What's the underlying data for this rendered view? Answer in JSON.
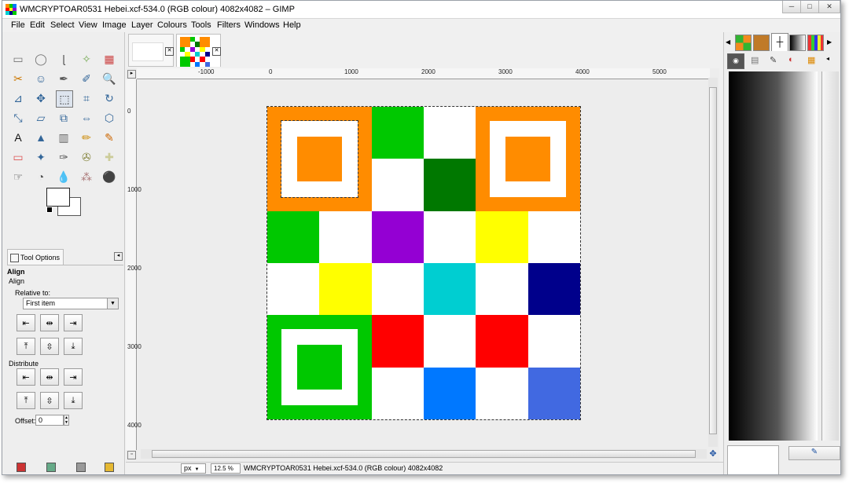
{
  "window": {
    "title": "WMCRYPTOAR0531 Hebei.xcf-534.0 (RGB colour) 4082x4082 – GIMP",
    "minimize": "─",
    "restore": "□",
    "close": "✕"
  },
  "menu": [
    "File",
    "Edit",
    "Select",
    "View",
    "Image",
    "Layer",
    "Colours",
    "Tools",
    "Filters",
    "Windows",
    "Help"
  ],
  "toolbox": {
    "tool_options_tab": "Tool Options",
    "section_title": "Align",
    "section_subtitle": "Align",
    "relative_to_label": "Relative to:",
    "relative_to_value": "First item",
    "distribute_label": "Distribute",
    "offset_label": "Offset:",
    "offset_value": "0",
    "tools": [
      "rect-select",
      "ellipse-select",
      "free-select",
      "fuzzy-select",
      "select-by-color",
      "scissors",
      "foreground-select",
      "paths",
      "color-picker",
      "zoom",
      "measure",
      "move",
      "align",
      "crop",
      "rotate",
      "scale",
      "shear",
      "perspective",
      "flip",
      "cage-transform",
      "text",
      "bucket-fill",
      "blend",
      "pencil",
      "paintbrush",
      "eraser",
      "airbrush",
      "ink",
      "clone",
      "heal",
      "smudge",
      "dodge-burn",
      "blur-sharpen",
      "convolve",
      "fill"
    ]
  },
  "ruler": {
    "h_labels": [
      "-1000",
      "0",
      "1000",
      "2000",
      "3000",
      "4000",
      "5000"
    ],
    "v_labels": [
      "0",
      "1000",
      "2000",
      "3000",
      "4000"
    ]
  },
  "status": {
    "unit": "px",
    "zoom": "12.5 %",
    "text": "WMCRYPTOAR0531 Hebei.xcf-534.0 (RGB colour) 4082x4082"
  },
  "colors": {
    "orange": "#ff8c00",
    "green": "#00c800",
    "darkgreen": "#007800",
    "purple": "#9400d3",
    "yellow": "#ffff00",
    "cyan": "#00ced1",
    "navy": "#00008b",
    "red": "#ff0000",
    "blue": "#0078ff",
    "royal": "#4169e1",
    "white": "#ffffff"
  },
  "image_grid": [
    [
      "orange",
      "orange",
      "green",
      "white",
      "orange",
      "orange"
    ],
    [
      "orange",
      "orange",
      "white",
      "darkgreen",
      "orange",
      "orange"
    ],
    [
      "green",
      "white",
      "purple",
      "white",
      "yellow",
      "white"
    ],
    [
      "white",
      "yellow",
      "white",
      "cyan",
      "white",
      "navy"
    ],
    [
      "green",
      "green",
      "red",
      "white",
      "red",
      "white"
    ],
    [
      "green",
      "green",
      "white",
      "blue",
      "white",
      "royal"
    ]
  ]
}
